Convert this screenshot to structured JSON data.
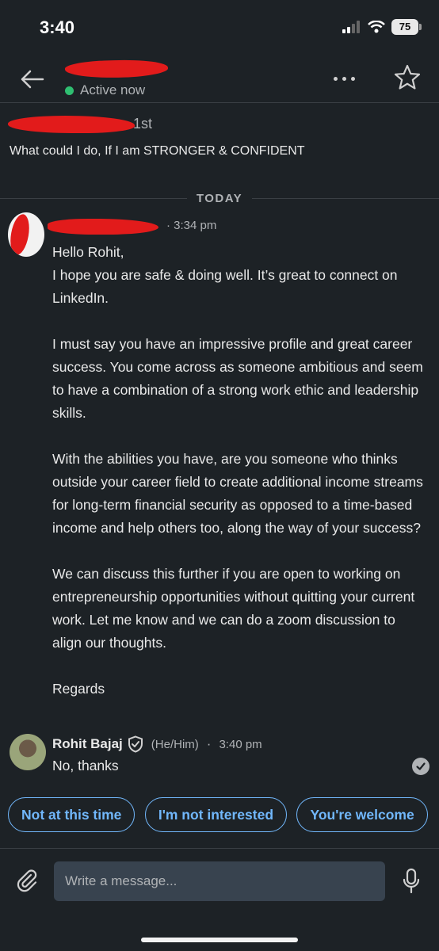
{
  "status_bar": {
    "time": "3:40",
    "battery": "75"
  },
  "header": {
    "status": "Active now"
  },
  "profile": {
    "degree": "1st",
    "headline": "What could I do, If I am STRONGER & CONFIDENT"
  },
  "divider": {
    "label": "TODAY"
  },
  "message1": {
    "time": "· 3:34 pm",
    "paragraphs": [
      "Hello Rohit,",
      "I hope you are safe & doing well. It’s great to connect on LinkedIn.",
      "I must say you have an impressive profile and great career success. You come across as someone ambitious and seem to have a combination of a strong work ethic and leadership skills.",
      "With the abilities you have, are you someone who thinks outside your career field to create additional income streams for long-term financial security as opposed to a time-based income and help others too, along the way of your success?",
      "We can discuss this further if you are open to working on entrepreneurship opportunities without quitting your current work. Let me know and we can do a zoom discussion to align our thoughts.",
      "Regards"
    ]
  },
  "message2": {
    "sender": "Rohit Bajaj",
    "pronouns": "(He/Him)",
    "time": "3:40 pm",
    "text": "No, thanks"
  },
  "suggestions": [
    "Not at this time",
    "I'm not interested",
    "You're welcome"
  ],
  "composer": {
    "placeholder": "Write a message..."
  },
  "colors": {
    "background": "#1d2226",
    "accent": "#71b7fb",
    "online": "#2fbf71",
    "redaction": "#e21b1b"
  },
  "icons": [
    "back-arrow-icon",
    "more-icon",
    "star-icon",
    "verified-shield-icon",
    "read-check-icon",
    "paperclip-icon",
    "microphone-icon"
  ]
}
